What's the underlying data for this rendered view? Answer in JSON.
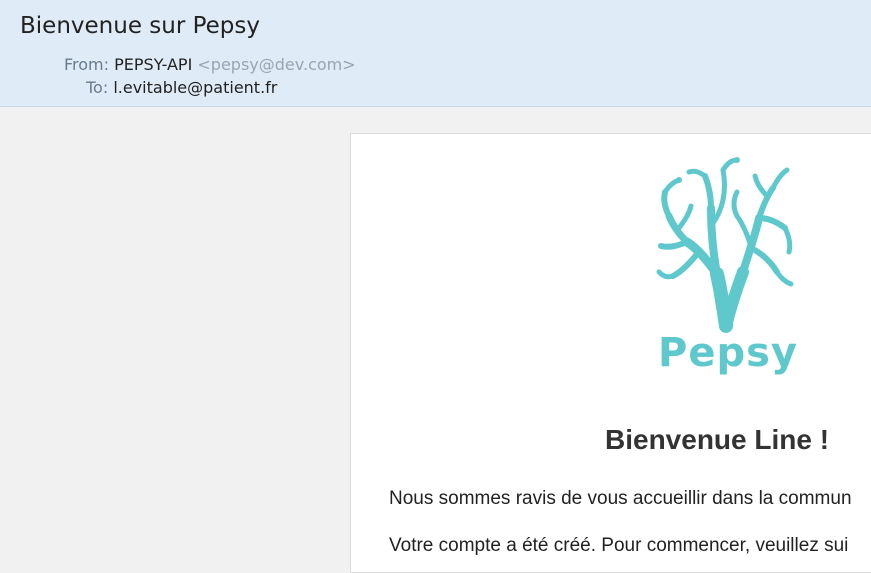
{
  "email": {
    "subject": "Bienvenue sur Pepsy",
    "from_label": "From:",
    "from_name": "PEPSY-API",
    "from_address": "<pepsy@dev.com>",
    "to_label": "To:",
    "to_address": "l.evitable@patient.fr"
  },
  "message": {
    "logo_text": "Pepsy",
    "logo_icon": "coral-icon",
    "heading": "Bienvenue Line !",
    "paragraph_1": "Nous sommes ravis de vous accueillir dans la commun",
    "paragraph_2": "Votre compte a été créé. Pour commencer, veuillez sui"
  },
  "colors": {
    "header_bg": "#dfebf7",
    "brand": "#5ec8cd",
    "page_bg": "#f1f1f1"
  }
}
